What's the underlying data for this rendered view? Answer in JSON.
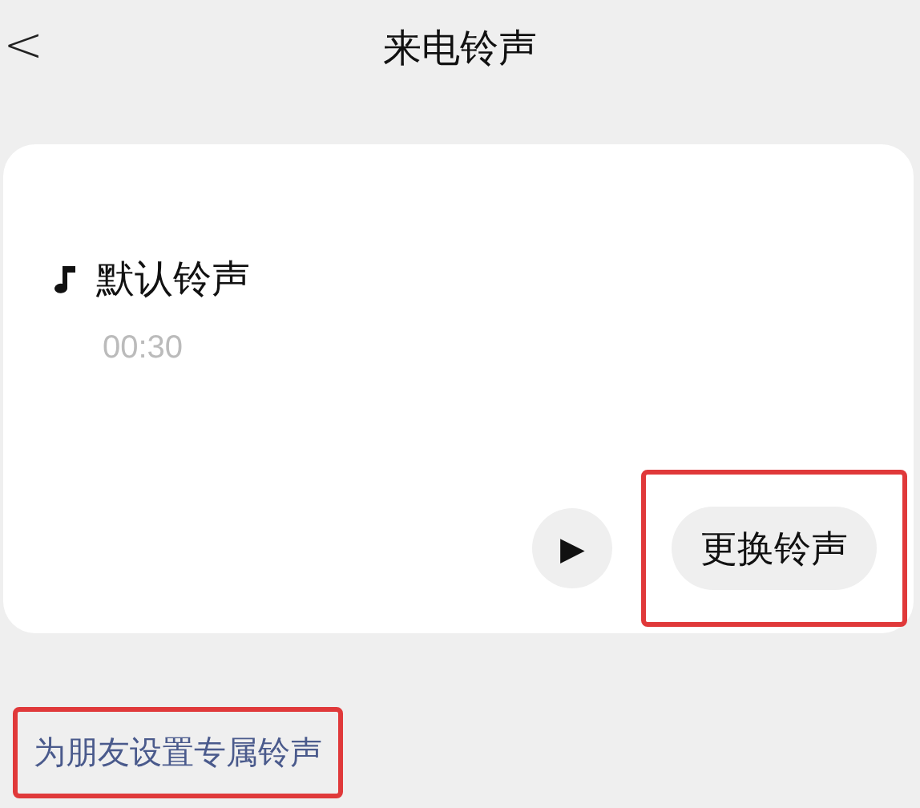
{
  "header": {
    "back": "<",
    "title": "来电铃声"
  },
  "ringtone": {
    "name": "默认铃声",
    "duration": "00:30"
  },
  "actions": {
    "play": "▶",
    "change": {
      "label": "更换铃声",
      "highlighted": true
    }
  },
  "friend_link": {
    "label": "为朋友设置专属铃声",
    "highlighted": true
  }
}
